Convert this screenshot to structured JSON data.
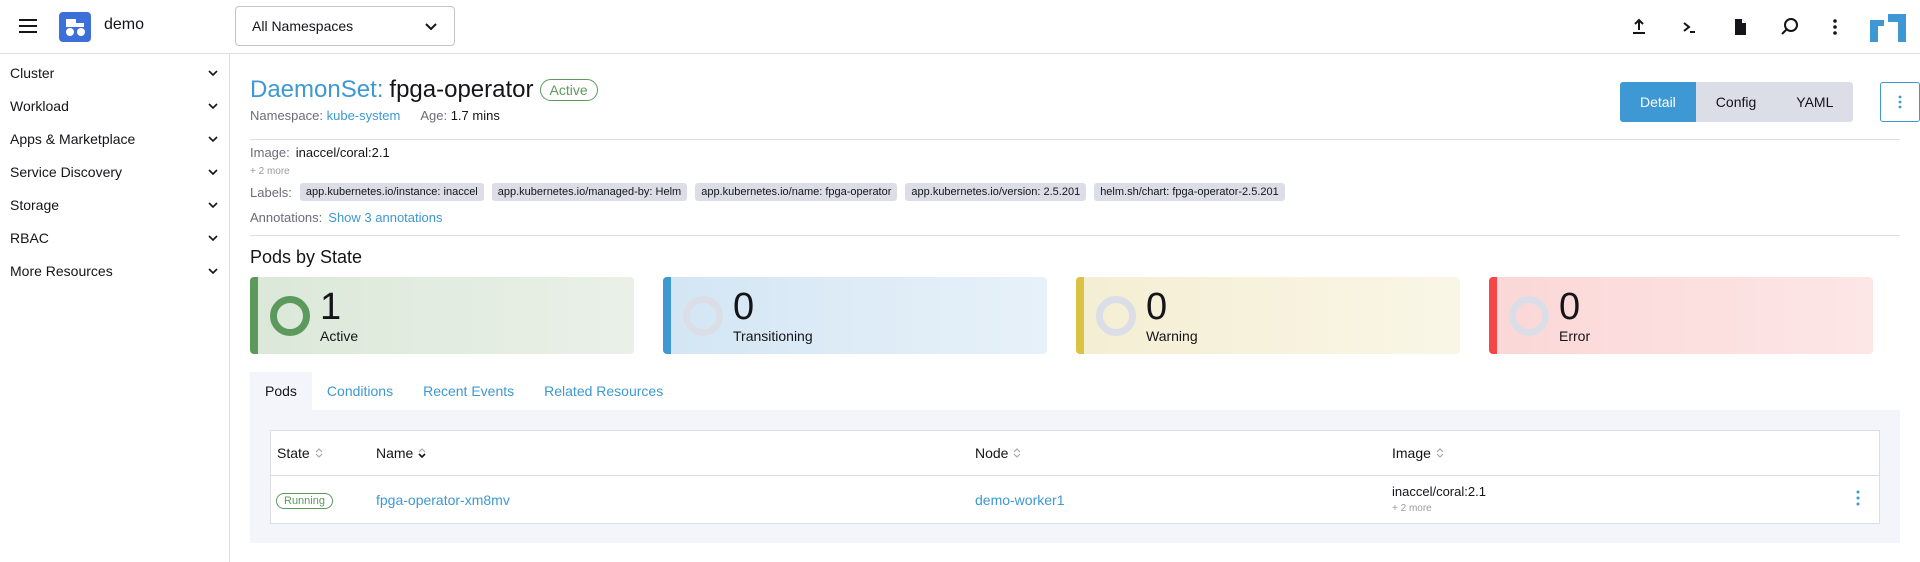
{
  "header": {
    "cluster_name": "demo",
    "namespace_select": "All Namespaces",
    "icons": [
      "upload-icon",
      "terminal-icon",
      "file-icon",
      "search-icon",
      "more-vertical-icon"
    ]
  },
  "sidebar": {
    "items": [
      {
        "label": "Cluster"
      },
      {
        "label": "Workload"
      },
      {
        "label": "Apps & Marketplace"
      },
      {
        "label": "Service Discovery"
      },
      {
        "label": "Storage"
      },
      {
        "label": "RBAC"
      },
      {
        "label": "More Resources"
      }
    ]
  },
  "resource": {
    "type": "DaemonSet:",
    "name": "fpga-operator",
    "status": "Active",
    "namespace_label": "Namespace:",
    "namespace": "kube-system",
    "age_label": "Age:",
    "age": "1.7 mins",
    "image_label": "Image:",
    "image": "inaccel/coral:2.1",
    "more_images": "+ 2 more",
    "labels_label": "Labels:",
    "labels": [
      "app.kubernetes.io/instance: inaccel",
      "app.kubernetes.io/managed-by: Helm",
      "app.kubernetes.io/name: fpga-operator",
      "app.kubernetes.io/version: 2.5.201",
      "helm.sh/chart: fpga-operator-2.5.201"
    ],
    "annotations_label": "Annotations:",
    "annotations_link": "Show 3 annotations"
  },
  "view_tabs": {
    "detail": "Detail",
    "config": "Config",
    "yaml": "YAML"
  },
  "pods_by_state": {
    "title": "Pods by State",
    "cards": [
      {
        "count": "1",
        "label": "Active",
        "color": "#5d995d"
      },
      {
        "count": "0",
        "label": "Transitioning",
        "color": "#3d98d3"
      },
      {
        "count": "0",
        "label": "Warning",
        "color": "#dac342"
      },
      {
        "count": "0",
        "label": "Error",
        "color": "#f64747"
      }
    ]
  },
  "tabs": [
    "Pods",
    "Conditions",
    "Recent Events",
    "Related Resources"
  ],
  "table": {
    "headers": [
      "State",
      "Name",
      "Node",
      "Image"
    ],
    "rows": [
      {
        "state": "Running",
        "name": "fpga-operator-xm8mv",
        "node": "demo-worker1",
        "image": "inaccel/coral:2.1",
        "image_more": "+ 2 more"
      }
    ]
  }
}
